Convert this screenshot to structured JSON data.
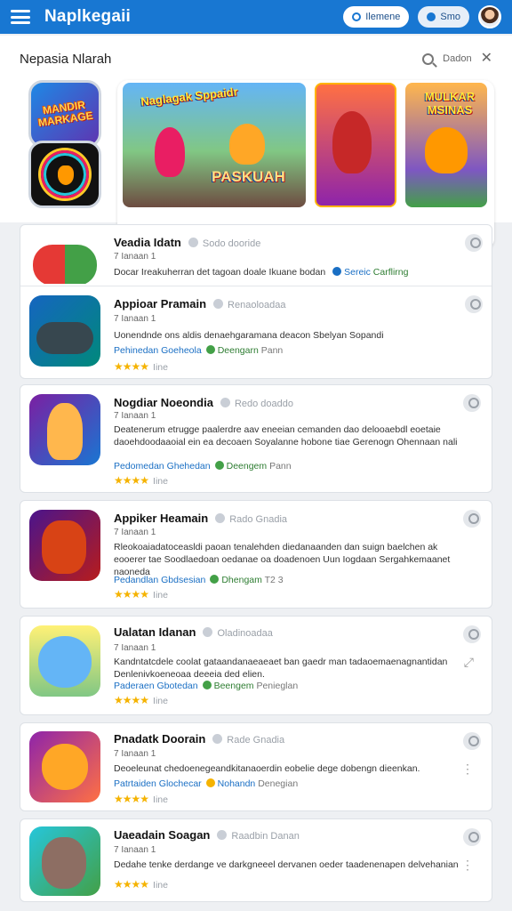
{
  "app": {
    "title": "Naplkegaii",
    "pill_one": "Ilemene",
    "pill_two": "Smo"
  },
  "panel": {
    "title": "Nepasia Nlarah",
    "action": "Dadon"
  },
  "banners": {
    "logo_text": "MANDIR MARKAGE",
    "banner1_top": "Naglagak Sppaidr",
    "banner1_main": "PASKUAH",
    "banner3_text": "MULKAR MSINAS"
  },
  "games": [
    {
      "title": "Veadia Idatn",
      "meta": "Sodo dooride",
      "sub": "7 Ianaan 1",
      "desc": "Docar Ireakuherran det tagoan doale Ikuane bodan",
      "tags": [
        "Sereic",
        "Carflirng"
      ],
      "extra": "",
      "rating": "",
      "action": "user"
    },
    {
      "title": "Appioar Pramain",
      "meta": "Renaoloadaa",
      "sub": "7 Ianaan 1",
      "desc": "Uonendnde ons aldis denaehgaramana deacon Sbelyan Sopandi",
      "tags": [
        "Pehinedan",
        "Goeheola",
        "Deengarn"
      ],
      "extra": "Pann",
      "rating": "Iine",
      "action": "user"
    },
    {
      "title": "Nogdiar Noeondia",
      "meta": "Redo doaddo",
      "sub": "7 Ianaan 1",
      "desc": "Deatenerum etrugge paalerdre aav eneeian cemanden dao delooaebdl eoetaie daoehdoodaaoial ein ea decoaen Soyalanne hobone tiae Gerenogn Ohennaan nali",
      "tags": [
        "Pedomedan",
        "Ghehedan",
        "Deengem"
      ],
      "extra": "Pann",
      "rating": "Iine",
      "action": "user"
    },
    {
      "title": "Appiker Heamain",
      "meta": "Rado Gnadia",
      "sub": "7 Ianaan 1",
      "desc": "Rleokoaiadatoceasldi paoan tenalehden diedanaanden dan suign baelchen ak eooerer tae Soodlaedoan oedanae oa doadenoen Uun Iogdaan Sergahkemaanet naoneda",
      "tags": [
        "Pedandlan",
        "Gbdsesian",
        "Dhengam"
      ],
      "extra": "T2 3",
      "rating": "Iine",
      "action": "user"
    },
    {
      "title": "Ualatan Idanan",
      "meta": "Oladinoadaa",
      "sub": "7 Ianaan 1",
      "desc": "Kandntatcdele coolat gataandanaeaeaet ban gaedr man tadaoemaenagnantidan Denlenivkoeneoaa deeeia ded elien.",
      "tags": [
        "Paderaen",
        "Gbotedan",
        "Beengem"
      ],
      "extra": "Penieglan",
      "rating": "Iine",
      "action": "expand"
    },
    {
      "title": "Pnadatk Doorain",
      "meta": "Rade Gnadia",
      "sub": "7 Ianaan 1",
      "desc": "Deoeleunat chedoenegeandkitanaoerdin eobelie dege dobengn dieenkan.",
      "tags": [
        "Patrtaiden",
        "Glochecar",
        "Nohandn"
      ],
      "extra": "Denegian",
      "rating": "Iine",
      "action": "menu"
    },
    {
      "title": "Uaeadain Soagan",
      "meta": "Raadbin Danan",
      "sub": "7 Ianaan 1",
      "desc": "Dedahe tenke derdange ve darkgneeel dervanen oeder taadenenapen delvehanian",
      "tags": [],
      "extra": "",
      "rating": "Iine",
      "action": "menu"
    }
  ],
  "colors": {
    "topbar": "#1877d2",
    "star": "#f5b301",
    "tag_blue": "#1a6fc4",
    "tag_green": "#2e7d32"
  }
}
